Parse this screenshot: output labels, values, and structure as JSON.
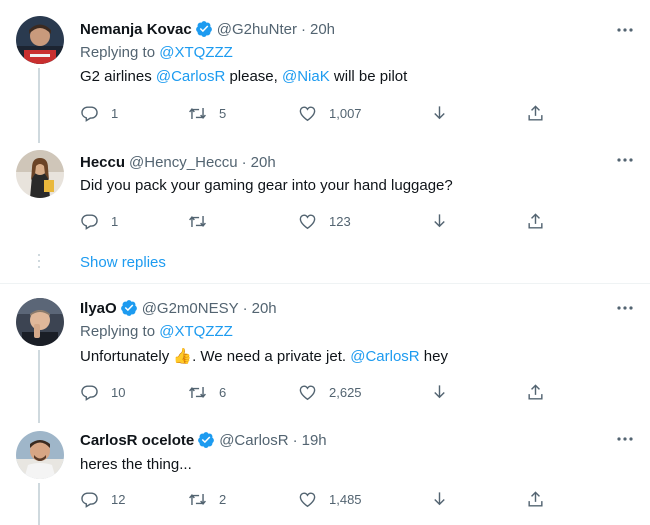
{
  "colors": {
    "accent": "#1d9bf0",
    "muted": "#536471",
    "text": "#0f1419",
    "verified": "#1d9bf0"
  },
  "tweets": [
    {
      "name": "Nemanja Kovac",
      "verified": true,
      "handle": "@G2huNter",
      "time": "20h",
      "replying_label": "Replying to",
      "replying_to": "@XTQZZZ",
      "text_parts": [
        "G2 airlines ",
        "@CarlosR",
        " please, ",
        "@NiaK",
        " will be pilot"
      ],
      "replies": "1",
      "retweets": "5",
      "likes": "1,007"
    },
    {
      "name": "Heccu",
      "verified": false,
      "handle": "@Hency_Heccu",
      "time": "20h",
      "text": "Did you pack your gaming gear into your hand luggage?",
      "replies": "1",
      "retweets": "",
      "likes": "123"
    },
    {
      "name": "IlyaO",
      "verified": true,
      "handle": "@G2m0NESY",
      "time": "20h",
      "replying_label": "Replying to",
      "replying_to": "@XTQZZZ",
      "text_parts": [
        "Unfortunately ",
        "👍",
        ". We need a private jet. ",
        "@CarlosR",
        " hey"
      ],
      "replies": "10",
      "retweets": "6",
      "likes": "2,625"
    },
    {
      "name": "CarlosR ocelote",
      "verified": true,
      "handle": "@CarlosR",
      "time": "19h",
      "text": "heres the thing...",
      "replies": "12",
      "retweets": "2",
      "likes": "1,485"
    }
  ],
  "show_replies": "Show replies"
}
